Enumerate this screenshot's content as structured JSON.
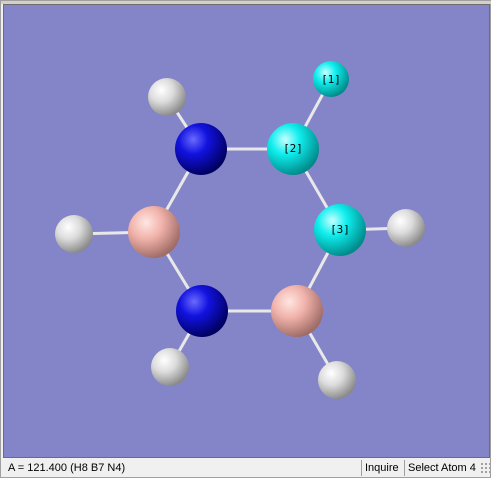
{
  "viewer": {
    "background_color": "#8484c8",
    "element_colors": {
      "H": "#e8e8e8",
      "B": "#f4b8b0",
      "N": "#1010e0",
      "selected": "#00f0f0"
    }
  },
  "atom_labels": {
    "atom1": "[1]",
    "atom2": "[2]",
    "atom3": "[3]"
  },
  "statusbar": {
    "measurement": "A = 121.400 (H8 B7 N4)",
    "mode": "Inquire",
    "action": "Select Atom 4"
  }
}
